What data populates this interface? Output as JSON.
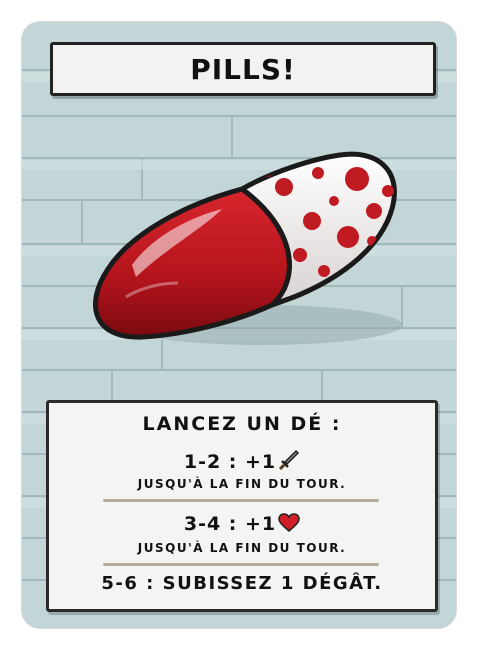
{
  "card": {
    "title": "PILLS!",
    "rules": {
      "heading": "LANCEZ UN DÉ :",
      "roll_1_2": {
        "label": "1-2 : +1",
        "icon": "sword-icon",
        "subtext": "JUSQU'À LA FIN DU TOUR."
      },
      "roll_3_4": {
        "label": "3-4 : +1",
        "icon": "heart-icon",
        "subtext": "JUSQU'À LA FIN DU TOUR."
      },
      "roll_5_6": {
        "label": "5-6 : SUBISSEZ 1 DÉGÂT."
      }
    },
    "art": {
      "subject": "pill-capsule",
      "colors": {
        "red": "#b4141c",
        "white": "#f0ecec",
        "spots": "#c01a22"
      }
    },
    "colors": {
      "background": "#bfd3d4",
      "plank_line": "#9fb6b8",
      "banner": "#f2f2f0",
      "divider": "#b5ab98"
    }
  }
}
